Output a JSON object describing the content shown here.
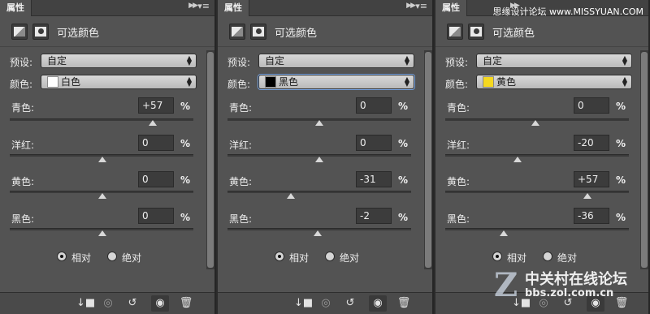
{
  "panel_tab": "属性",
  "adjustment_title": "可选颜色",
  "preset_label": "预设:",
  "preset_value": "自定",
  "colors_label": "颜色:",
  "slider_labels": [
    "青色:",
    "洋红:",
    "黄色:",
    "黑色:"
  ],
  "percent": "%",
  "radio_relative": "相对",
  "radio_absolute": "绝对",
  "panels": [
    {
      "color_name": "白色",
      "swatch": "#ffffff",
      "values": [
        "+57",
        "0",
        "0",
        "0"
      ],
      "numeric": [
        57,
        0,
        0,
        0
      ]
    },
    {
      "color_name": "黑色",
      "swatch": "#000000",
      "values": [
        "0",
        "0",
        "-31",
        "-2"
      ],
      "numeric": [
        0,
        0,
        -31,
        -2
      ]
    },
    {
      "color_name": "黄色",
      "swatch": "#f5d820",
      "values": [
        "0",
        "-20",
        "+57",
        "-36"
      ],
      "numeric": [
        0,
        -20,
        57,
        -36
      ]
    }
  ],
  "icons": {
    "collapse": "double-arrow-icon",
    "menu": "panel-menu-icon",
    "clip": "clip-to-layer-icon",
    "view_previous": "view-previous-state-icon",
    "reset": "reset-icon",
    "visibility": "eye-icon",
    "delete": "trash-icon"
  },
  "watermark": {
    "top": "思缘设计论坛 www.MISSYUAN.COM",
    "site": "中关村在线论坛",
    "url": "bbs.zol.com.cn",
    "logo": "Z"
  }
}
